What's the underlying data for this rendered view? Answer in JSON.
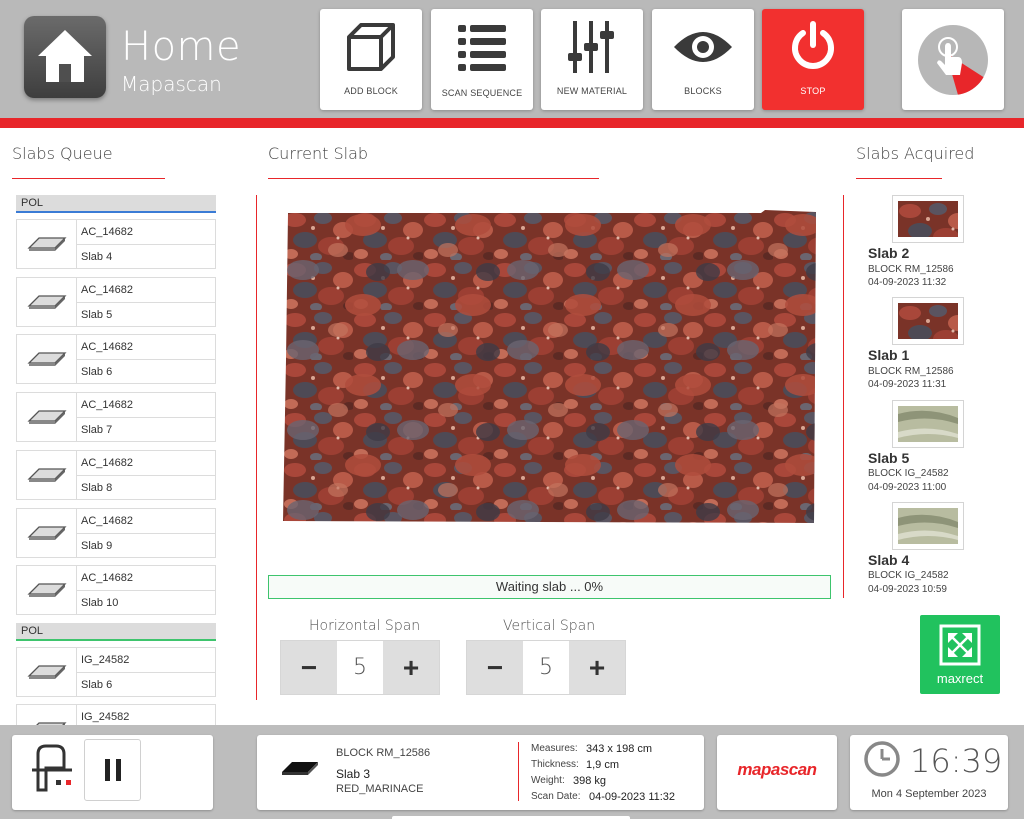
{
  "header": {
    "title": "Home",
    "subtitle": "Mapascan",
    "home_icon": "home-icon",
    "buttons": [
      {
        "label": "ADD BLOCK",
        "icon": "cube-icon"
      },
      {
        "label": "SCAN SEQUENCE",
        "icon": "list-icon"
      },
      {
        "label": "NEW MATERIAL",
        "icon": "sliders-icon"
      },
      {
        "label": "BLOCKS",
        "icon": "eye-icon"
      },
      {
        "label": "STOP",
        "icon": "power-icon"
      }
    ],
    "touch_icon": "touch-icon"
  },
  "colors": {
    "accent": "#e8262a",
    "stop": "#f2302f",
    "success": "#21c25e",
    "header_bg": "#b9b9b9"
  },
  "queue": {
    "title": "Slabs Queue",
    "groups": [
      {
        "label": "POL",
        "items": [
          {
            "code": "AC_14682",
            "slab": "Slab 4"
          },
          {
            "code": "AC_14682",
            "slab": "Slab 5"
          },
          {
            "code": "AC_14682",
            "slab": "Slab 6"
          },
          {
            "code": "AC_14682",
            "slab": "Slab 7"
          },
          {
            "code": "AC_14682",
            "slab": "Slab 8"
          },
          {
            "code": "AC_14682",
            "slab": "Slab 9"
          },
          {
            "code": "AC_14682",
            "slab": "Slab 10"
          }
        ]
      },
      {
        "label": "POL",
        "items": [
          {
            "code": "IG_24582",
            "slab": "Slab 6"
          },
          {
            "code": "IG_24582",
            "slab": ""
          }
        ]
      }
    ]
  },
  "current": {
    "title": "Current Slab",
    "progress_text": "Waiting slab ... 0%",
    "progress": 0,
    "horizontal_span": {
      "label": "Horizontal Span",
      "value": "5"
    },
    "vertical_span": {
      "label": "Vertical Span",
      "value": "5"
    },
    "minus": "−",
    "plus": "+"
  },
  "acquired": {
    "title": "Slabs Acquired",
    "items": [
      {
        "name": "Slab 2",
        "block": "BLOCK RM_12586",
        "date": "04-09-2023 11:32",
        "material": "red"
      },
      {
        "name": "Slab 1",
        "block": "BLOCK RM_12586",
        "date": "04-09-2023 11:31",
        "material": "red"
      },
      {
        "name": "Slab 5",
        "block": "BLOCK IG_24582",
        "date": "04-09-2023 11:00",
        "material": "green"
      },
      {
        "name": "Slab 4",
        "block": "BLOCK IG_24582",
        "date": "04-09-2023 10:59",
        "material": "green"
      }
    ],
    "maxrect_label": "maxrect"
  },
  "footer": {
    "block": "BLOCK RM_12586",
    "slab": "Slab 3",
    "material": "RED_MARINACE",
    "measures_label": "Measures:",
    "measures": "343 x 198 cm",
    "thickness_label": "Thickness:",
    "thickness": "1,9 cm",
    "weight_label": "Weight:",
    "weight": "398 kg",
    "scan_date_label": "Scan Date:",
    "scan_date": "04-09-2023 11:32",
    "brand": "mapascan",
    "time": "16:39",
    "date": "Mon 4 September 2023"
  }
}
